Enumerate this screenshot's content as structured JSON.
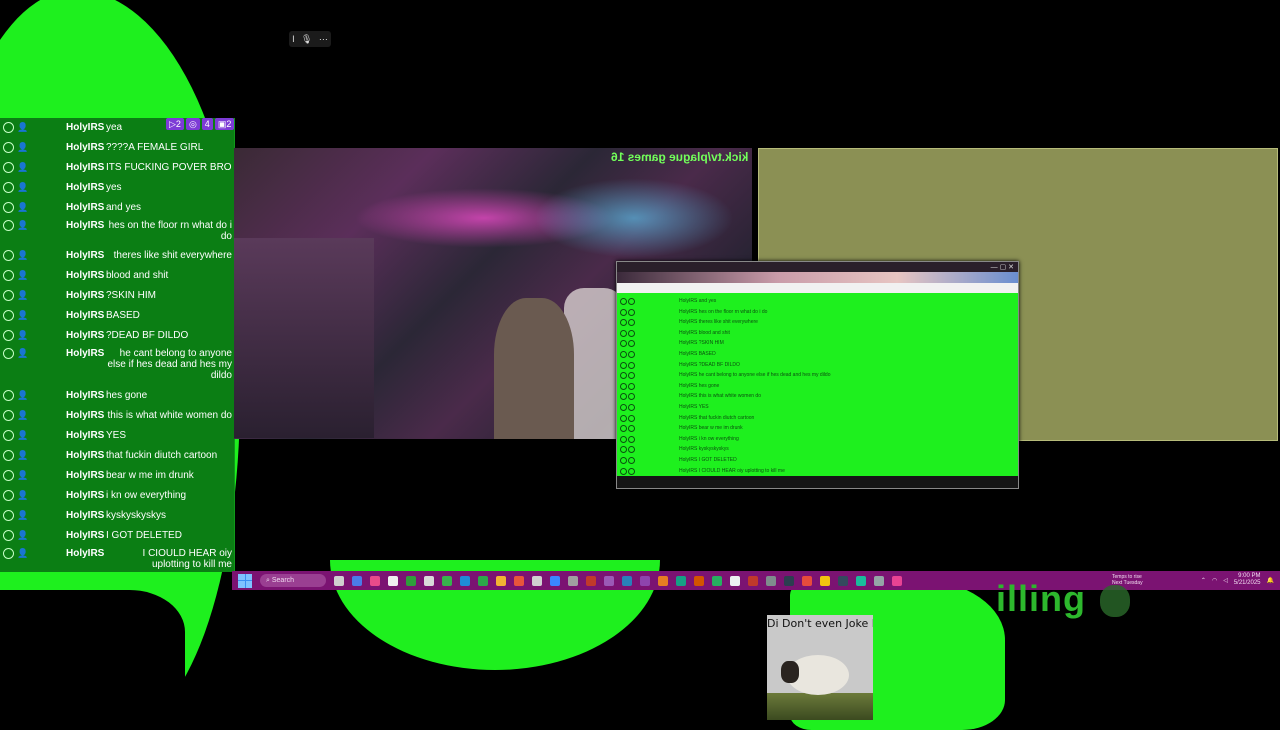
{
  "mini_toolbar": {
    "icons": [
      "cursor-icon",
      "mic-icon",
      "more-icon"
    ],
    "glyphs": [
      "I",
      "🎙",
      "⋯"
    ]
  },
  "chat": {
    "badges": [
      {
        "name": "viewers",
        "label": "▷2",
        "color": "#7d3bd6"
      },
      {
        "name": "followers",
        "label": "◎",
        "color": "#7d3bd6"
      },
      {
        "name": "count",
        "label": "4",
        "color": "#7d3bd6"
      },
      {
        "name": "messages",
        "label": "▣2",
        "color": "#7d3bd6"
      }
    ],
    "messages": [
      {
        "user": "HolyIRS",
        "text": "yea"
      },
      {
        "user": "HolyIRS",
        "text": "????A FEMALE GIRL"
      },
      {
        "user": "HolyIRS",
        "text": "ITS FUCKING POVER BRO"
      },
      {
        "user": "HolyIRS",
        "text": "yes"
      },
      {
        "user": "HolyIRS",
        "text": "and yes"
      },
      {
        "user": "HolyIRS",
        "text": "hes on the floor rn what do i do"
      },
      {
        "user": "HolyIRS",
        "text": "theres like shit everywhere"
      },
      {
        "user": "HolyIRS",
        "text": "blood and shit"
      },
      {
        "user": "HolyIRS",
        "text": "?SKIN HIM"
      },
      {
        "user": "HolyIRS",
        "text": "BASED"
      },
      {
        "user": "HolyIRS",
        "text": "?DEAD BF DILDO"
      },
      {
        "user": "HolyIRS",
        "text": "he cant belong to anyone else if hes dead and hes my dildo"
      },
      {
        "user": "HolyIRS",
        "text": "hes gone"
      },
      {
        "user": "HolyIRS",
        "text": "this is what white women do"
      },
      {
        "user": "HolyIRS",
        "text": "YES"
      },
      {
        "user": "HolyIRS",
        "text": "that fuckin diutch cartoon"
      },
      {
        "user": "HolyIRS",
        "text": "bear w me im drunk"
      },
      {
        "user": "HolyIRS",
        "text": "i kn ow everything"
      },
      {
        "user": "HolyIRS",
        "text": "kyskyskyskys"
      },
      {
        "user": "HolyIRS",
        "text": "I GOT DELETED"
      },
      {
        "user": "HolyIRS",
        "text": "I CIOULD HEAR oiy uplotting to kill me"
      }
    ]
  },
  "stream": {
    "title": "kick.tv/plague games 16"
  },
  "browser": {
    "rows": [
      "HolyIRS and yes",
      "HolyIRS hes on the floor rn what do i do",
      "HolyIRS theres like shit everywhere",
      "HolyIRS blood and shit",
      "HolyIRS ?SKIN HIM",
      "HolyIRS BASED",
      "HolyIRS ?DEAD BF DILDO",
      "HolyIRS he cant belong to anyone else if hes dead and hes my dildo",
      "HolyIRS hes gone",
      "HolyIRS this is what white women do",
      "HolyIRS YES",
      "HolyIRS that fuckin diutch cartoon",
      "HolyIRS bear w me im drunk",
      "HolyIRS i kn ow everything",
      "HolyIRS kyskyskyskys",
      "HolyIRS I GOT DELETED",
      "HolyIRS I CIOULD HEAR oiy uplotting to kill me"
    ]
  },
  "taskbar": {
    "search_label": "Search",
    "weather_line1": "Temps to rise",
    "weather_line2": "Next Tuesday",
    "time": "9:00 PM",
    "date": "5/21/2025",
    "app_colors": [
      "#cfcfcf",
      "#4b7be8",
      "#e84b8a",
      "#f0f0f0",
      "#2f9d3b",
      "#d9d9d9",
      "#37b24d",
      "#1f8bd6",
      "#2ca84a",
      "#f2b233",
      "#e8553c",
      "#d0d0d0",
      "#3a86ff",
      "#a0a0a0",
      "#c0392b",
      "#9b59b6",
      "#2980b9",
      "#8e44ad",
      "#e67e22",
      "#16a085",
      "#d35400",
      "#27ae60",
      "#ecf0f1",
      "#c0392b",
      "#7f8c8d",
      "#2c3e50",
      "#e74c3c",
      "#f1c40f",
      "#34495e",
      "#1abc9c",
      "#95a5a6",
      "#e84393"
    ]
  },
  "overlay": {
    "text": "illing"
  },
  "meme": {
    "caption": "Di Don't even Joke La"
  }
}
